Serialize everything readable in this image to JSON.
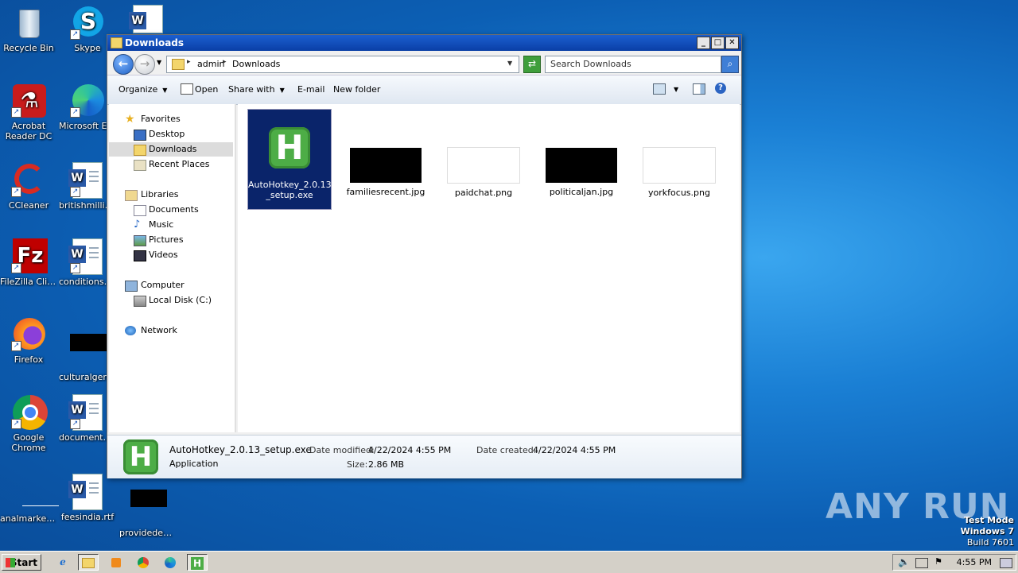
{
  "desktop": {
    "icons": [
      {
        "label": "Recycle Bin"
      },
      {
        "label": "Skype"
      },
      {
        "label": "Acrobat Reader DC"
      },
      {
        "label": "Microsoft Ed..."
      },
      {
        "label": "CCleaner"
      },
      {
        "label": "britishmillion..."
      },
      {
        "label": "FileZilla Client"
      },
      {
        "label": "conditionsgi..."
      },
      {
        "label": "Firefox"
      },
      {
        "label": "culturalgerm..."
      },
      {
        "label": "Google Chrome"
      },
      {
        "label": "documentat..."
      },
      {
        "label": "analmarketi..."
      },
      {
        "label": "feesindia.rtf"
      },
      {
        "label": "provideded..."
      }
    ]
  },
  "window": {
    "title": "Downloads",
    "buttons": {
      "minimize": "_",
      "maximize": "□",
      "close": "✕"
    },
    "address": {
      "crumbs": [
        "admin",
        "Downloads"
      ]
    },
    "search": {
      "placeholder": "Search Downloads"
    },
    "toolbar": {
      "organize": "Organize",
      "open": "Open",
      "share_with": "Share with",
      "email": "E-mail",
      "new_folder": "New folder"
    },
    "nav": {
      "favorites": "Favorites",
      "desktop": "Desktop",
      "downloads": "Downloads",
      "recent_places": "Recent Places",
      "libraries": "Libraries",
      "documents": "Documents",
      "music": "Music",
      "pictures": "Pictures",
      "videos": "Videos",
      "computer": "Computer",
      "local_disk": "Local Disk (C:)",
      "network": "Network"
    },
    "files": [
      {
        "name": "AutoHotkey_2.0.13_setup.exe",
        "line1": "AutoHotkey_2.0.13",
        "line2": "_setup.exe",
        "selected": true
      },
      {
        "name": "familiesrecent.jpg",
        "thumb": "#000000"
      },
      {
        "name": "paidchat.png",
        "thumb": "#ffffff"
      },
      {
        "name": "politicaljan.jpg",
        "thumb": "#000000"
      },
      {
        "name": "yorkfocus.png",
        "thumb": "#ffffff"
      }
    ],
    "details": {
      "filename": "AutoHotkey_2.0.13_setup.exe",
      "type": "Application",
      "date_modified_label": "Date modified:",
      "date_modified": "4/22/2024 4:55 PM",
      "size_label": "Size:",
      "size": "2.86 MB",
      "date_created_label": "Date created:",
      "date_created": "4/22/2024 4:55 PM"
    }
  },
  "taskbar": {
    "start": "Start",
    "clock": "4:55 PM"
  },
  "overlay": {
    "watermark": "ANY RUN",
    "test_mode": "Test Mode",
    "os": "Windows 7",
    "build": "Build 7601"
  },
  "colors": {
    "selection": "#0a246a",
    "ahk_green": "#4dad46",
    "title_blue": "#0a3fa6"
  }
}
